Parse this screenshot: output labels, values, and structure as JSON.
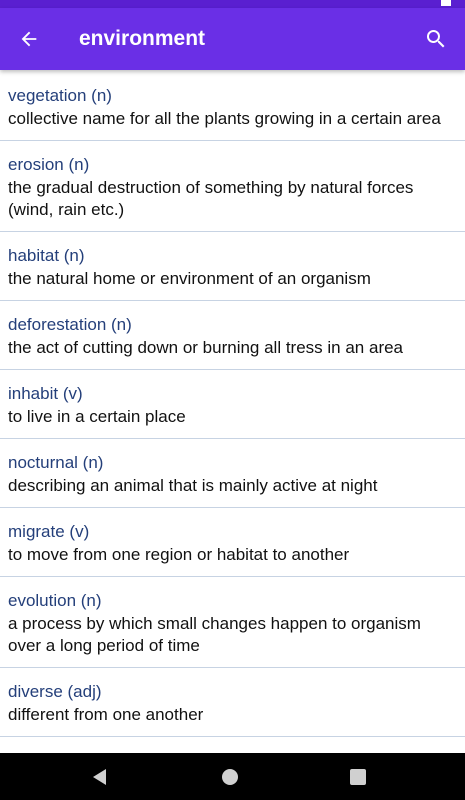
{
  "app_bar": {
    "title": "environment",
    "back_icon": "arrow-back-icon",
    "search_icon": "search-icon"
  },
  "colors": {
    "app_bar": "#6a2fe6",
    "status_bar": "#5a1fd0",
    "word": "#243f7a",
    "divider": "#c7d3e3"
  },
  "entries": [
    {
      "word": "vegetation (n)",
      "definition": "collective name for all the plants growing in a certain area"
    },
    {
      "word": "erosion (n)",
      "definition": "the gradual destruction of something by natural forces (wind, rain  etc.)"
    },
    {
      "word": "habitat (n)",
      "definition": "the natural home or environment of an organism"
    },
    {
      "word": "deforestation (n)",
      "definition": "the act of cutting down or burning all tress in an area"
    },
    {
      "word": "inhabit (v)",
      "definition": "to live in a certain place"
    },
    {
      "word": "nocturnal (n)",
      "definition": "describing an animal that is mainly active at night"
    },
    {
      "word": "migrate (v)",
      "definition": "to move from one region or habitat to another"
    },
    {
      "word": "evolution (n)",
      "definition": "a process by which small changes happen to organism over a long period of time"
    },
    {
      "word": "diverse (adj)",
      "definition": "different from one another"
    }
  ],
  "nav_bar": {
    "back_icon": "nav-back-icon",
    "home_icon": "nav-home-icon",
    "recents_icon": "nav-recents-icon"
  }
}
